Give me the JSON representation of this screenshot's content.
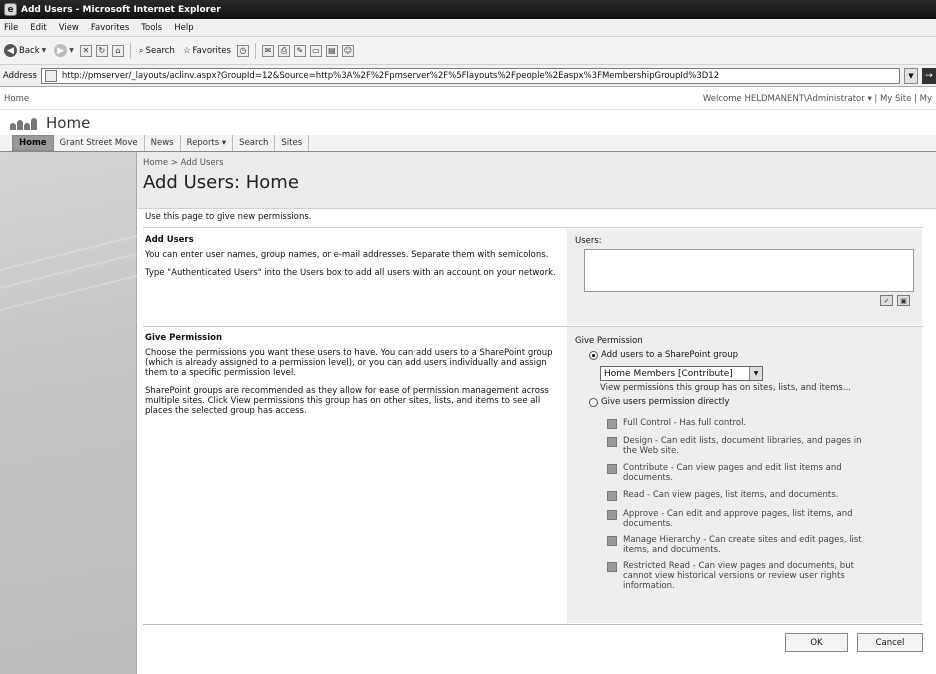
{
  "window": {
    "title": "Add Users - Microsoft Internet Explorer"
  },
  "menu": [
    "File",
    "Edit",
    "View",
    "Favorites",
    "Tools",
    "Help"
  ],
  "toolbar": {
    "back": "Back",
    "search": "Search",
    "favorites": "Favorites"
  },
  "address": {
    "label": "Address",
    "url": "http://pmserver/_layouts/aclinv.aspx?GroupId=12&Source=http%3A%2F%2Fpmserver%2F%5Flayouts%2Fpeople%2Easpx%3FMembershipGroupId%3D12"
  },
  "sp": {
    "home_link": "Home",
    "welcome": "Welcome HELDMANENT\\Administrator ▾ | My Site | My",
    "site_title": "Home",
    "tabs": [
      "Home",
      "Grant Street Move",
      "News",
      "Reports ▾",
      "Search",
      "Sites"
    ]
  },
  "page": {
    "breadcrumb": "Home > Add Users",
    "title": "Add Users: Home",
    "intro": "Use this page to give new permissions."
  },
  "add_users": {
    "heading": "Add Users",
    "desc1": "You can enter user names, group names, or e-mail addresses. Separate them with semicolons.",
    "desc2": "Type \"Authenticated Users\" into the Users box to add all users with an account on your network.",
    "users_label": "Users:",
    "users_value": ""
  },
  "give_permission": {
    "heading": "Give Permission",
    "desc1": "Choose the permissions you want these users to have. You can add users to a SharePoint group (which is already assigned to a permission level), or you can add users individually and assign them to a specific permission level.",
    "desc2": "SharePoint groups are recommended as they allow for ease of permission management across multiple sites. Click View permissions this group has on other sites, lists, and items to see all places the selected group has access.",
    "label": "Give Permission",
    "option_group": "Add users to a SharePoint group",
    "group_selected": "Home Members [Contribute]",
    "view_link": "View permissions this group has on sites, lists, and items...",
    "option_direct": "Give users permission directly",
    "levels": [
      "Full Control - Has full control.",
      "Design - Can edit lists, document libraries, and pages in the Web site.",
      "Contribute - Can view pages and edit list items and documents.",
      "Read - Can view pages, list items, and documents.",
      "Approve - Can edit and approve pages, list items, and documents.",
      "Manage Hierarchy - Can create sites and edit pages, list items, and documents.",
      "Restricted Read - Can view pages and documents, but cannot view historical versions or review user rights information."
    ]
  },
  "buttons": {
    "ok": "OK",
    "cancel": "Cancel"
  }
}
